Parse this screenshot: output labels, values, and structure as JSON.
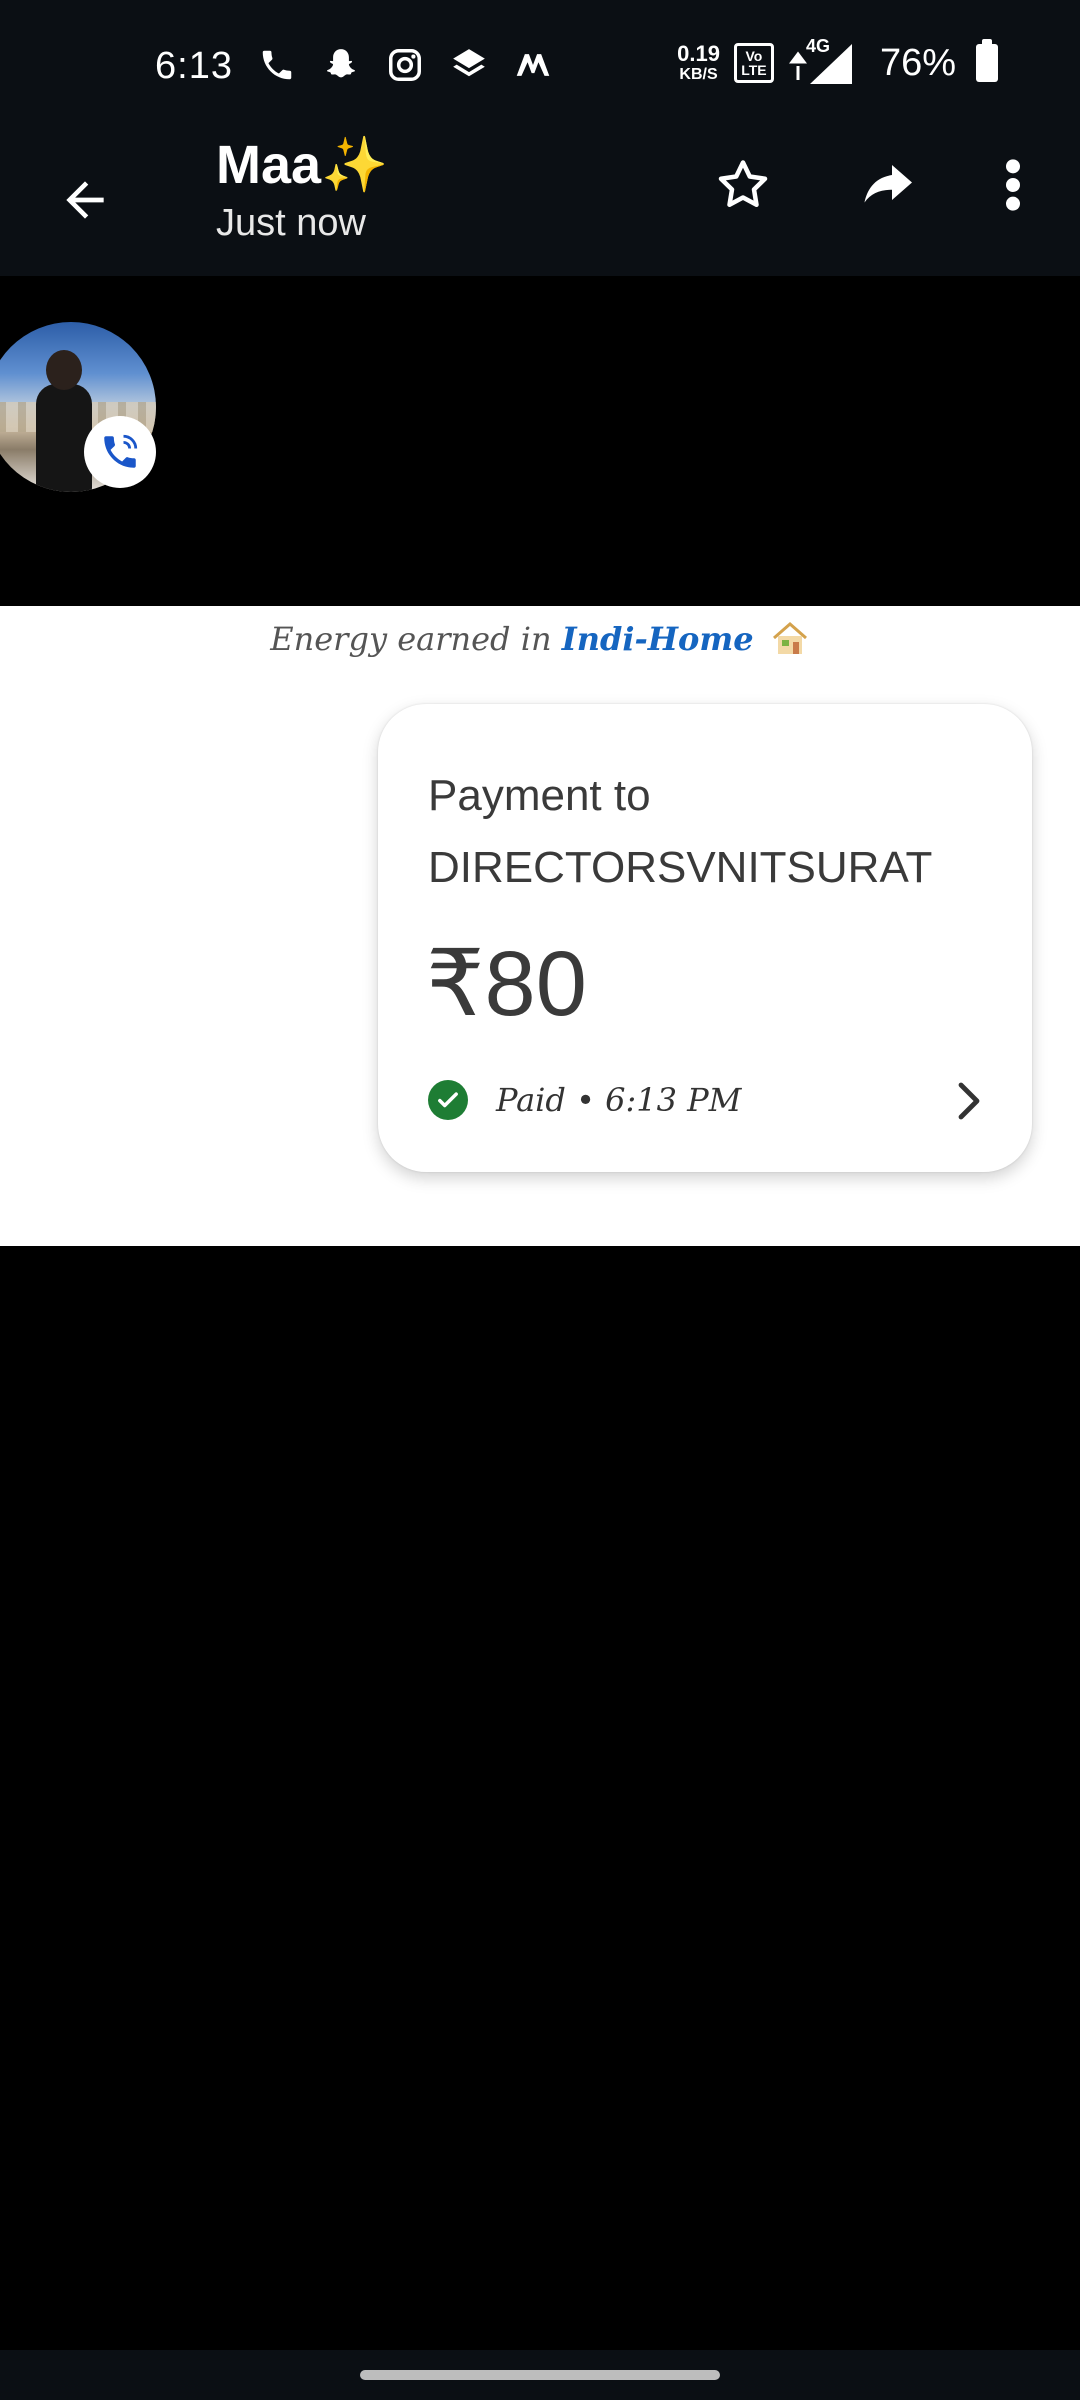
{
  "status_bar": {
    "time": "6:13",
    "net_speed_value": "0.19",
    "net_speed_unit": "KB/S",
    "volte_top": "Vo",
    "volte_bottom": "LTE",
    "network_type": "4G",
    "battery_percent": "76%",
    "left_icons": [
      "phone-icon",
      "snapchat-icon",
      "instagram-icon",
      "layers-icon",
      "myntra-icon"
    ]
  },
  "app_bar": {
    "title": "Maa✨",
    "subtitle": "Just now",
    "actions": [
      "back-arrow-icon",
      "star-icon",
      "share-icon",
      "more-vert-icon"
    ]
  },
  "message": {
    "banner_prefix": "Energy earned in",
    "banner_brand": "Indi-Home",
    "payment": {
      "title_line1": "Payment to",
      "title_line2": "DIRECTORSVNITSURAT",
      "amount": "₹80",
      "status": "Paid • 6:13 PM"
    }
  },
  "colors": {
    "bar_background": "#0b0f14",
    "chat_background": "#000000",
    "paid_green": "#1e7d34",
    "brand_blue": "#1565c0",
    "call_badge_blue": "#1a56c9"
  }
}
